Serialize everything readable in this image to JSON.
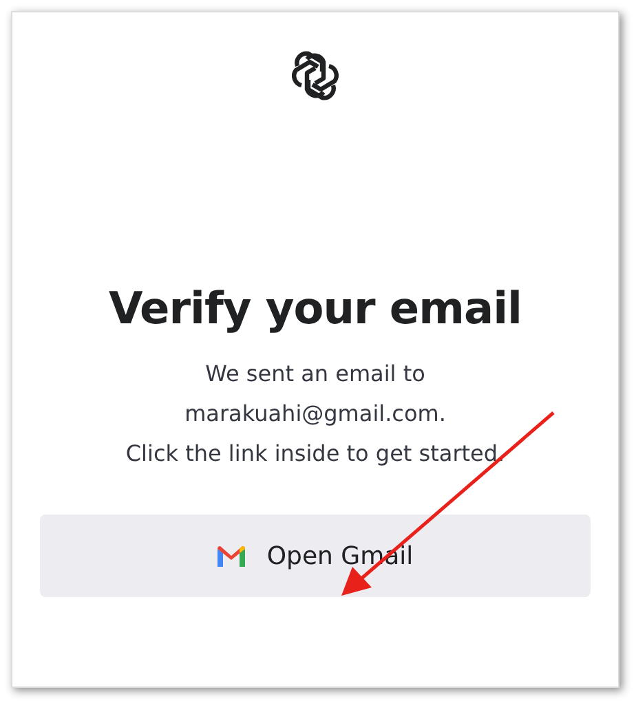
{
  "title": "Verify your email",
  "message": [
    "We sent an email to",
    "marakuahi@gmail.com.",
    "Click the link inside to get started."
  ],
  "button": {
    "label": "Open Gmail"
  }
}
